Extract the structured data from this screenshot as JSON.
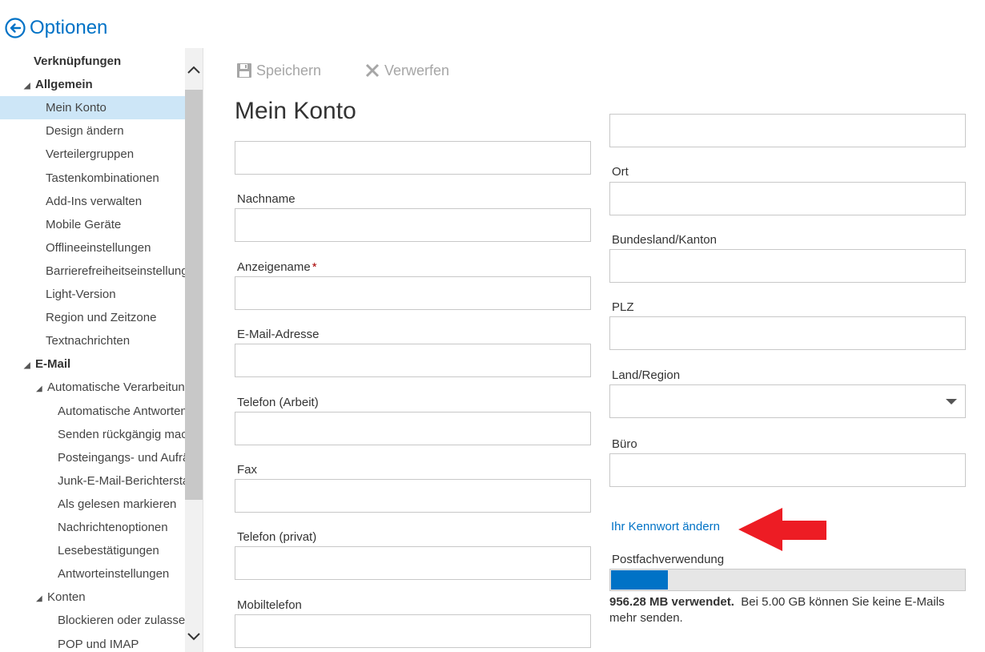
{
  "header": {
    "title": "Optionen",
    "back_icon": "arrow-left-circle-icon",
    "accent": "#0072c6"
  },
  "nav": {
    "items": [
      {
        "label": "Verknüpfungen",
        "level": 0,
        "bold": true,
        "expander": false
      },
      {
        "label": "Allgemein",
        "level": 0,
        "bold": true,
        "expander": true
      },
      {
        "label": "Mein Konto",
        "level": 1,
        "selected": true
      },
      {
        "label": "Design ändern",
        "level": 1
      },
      {
        "label": "Verteilergruppen",
        "level": 1
      },
      {
        "label": "Tastenkombinationen",
        "level": 1
      },
      {
        "label": "Add-Ins verwalten",
        "level": 1
      },
      {
        "label": "Mobile Geräte",
        "level": 1
      },
      {
        "label": "Offlineeinstellungen",
        "level": 1
      },
      {
        "label": "Barrierefreiheitseinstellungen",
        "level": 1
      },
      {
        "label": "Light-Version",
        "level": 1
      },
      {
        "label": "Region und Zeitzone",
        "level": 1
      },
      {
        "label": "Textnachrichten",
        "level": 1
      },
      {
        "label": "E-Mail",
        "level": 0,
        "bold": true,
        "expander": true
      },
      {
        "label": "Automatische Verarbeitung",
        "level": 1,
        "expander": true
      },
      {
        "label": "Automatische Antworten",
        "level": 2
      },
      {
        "label": "Senden rückgängig machen",
        "level": 2
      },
      {
        "label": "Posteingangs- und Aufräumregeln",
        "level": 2
      },
      {
        "label": "Junk-E-Mail-Berichterstattung",
        "level": 2
      },
      {
        "label": "Als gelesen markieren",
        "level": 2
      },
      {
        "label": "Nachrichtenoptionen",
        "level": 2
      },
      {
        "label": "Lesebestätigungen",
        "level": 2
      },
      {
        "label": "Antworteinstellungen",
        "level": 2
      },
      {
        "label": "Konten",
        "level": 1,
        "expander": true
      },
      {
        "label": "Blockieren oder zulassen",
        "level": 2
      },
      {
        "label": "POP und IMAP",
        "level": 2
      }
    ]
  },
  "toolbar": {
    "save_label": "Speichern",
    "save_icon": "floppy-disk-icon",
    "discard_label": "Verwerfen",
    "discard_icon": "x-icon"
  },
  "page_title": "Mein Konto",
  "form": {
    "left": [
      {
        "label": "",
        "value": ""
      },
      {
        "label": "Nachname",
        "value": ""
      },
      {
        "label": "Anzeigename",
        "required": true,
        "value": ""
      },
      {
        "label": "E-Mail-Adresse",
        "value": ""
      },
      {
        "label": "Telefon (Arbeit)",
        "value": ""
      },
      {
        "label": "Fax",
        "value": ""
      },
      {
        "label": "Telefon (privat)",
        "value": ""
      },
      {
        "label": "Mobiltelefon",
        "value": ""
      }
    ],
    "right": [
      {
        "label": "Ort",
        "value": ""
      },
      {
        "label": "Bundesland/Kanton",
        "value": ""
      },
      {
        "label": "PLZ",
        "value": ""
      },
      {
        "label": "Land/Region",
        "value": "",
        "type": "select"
      },
      {
        "label": "Büro",
        "value": ""
      }
    ],
    "required_marker": "*"
  },
  "password_link": "Ihr Kennwort ändern",
  "annotation_arrow_color": "#ed1c24",
  "mailbox": {
    "label": "Postfachverwendung",
    "usage_fraction": 0.16,
    "used_text": "956.28 MB verwendet.",
    "limit_text": "Bei 5.00 GB können Sie keine E-Mails mehr senden."
  }
}
